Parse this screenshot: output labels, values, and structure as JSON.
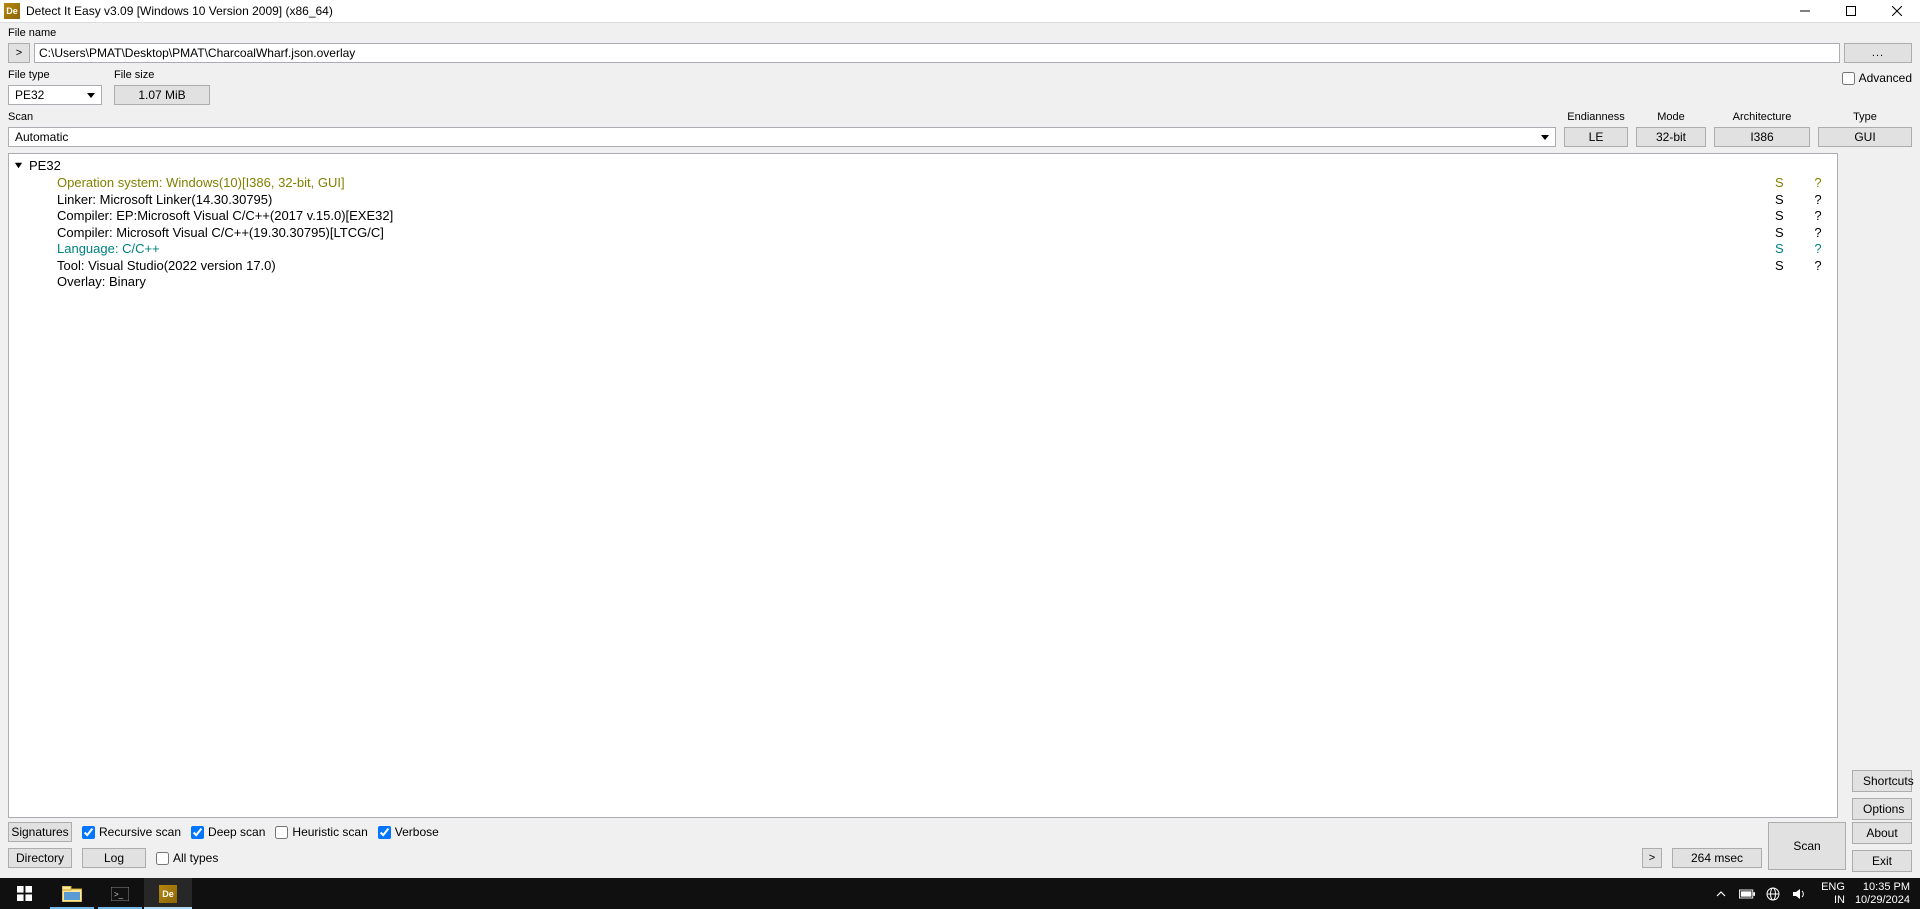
{
  "titlebar": {
    "app_icon": "De",
    "title": "Detect It Easy v3.09 [Windows 10 Version 2009] (x86_64)"
  },
  "file": {
    "filename_label": "File name",
    "path": "C:\\Users\\PMAT\\Desktop\\PMAT\\CharcoalWharf.json.overlay",
    "browse_button": "...",
    "go_button": ">",
    "filetype_label": "File type",
    "filetype_value": "PE32",
    "filesize_label": "File size",
    "filesize_value": "1.07 MiB",
    "advanced_label": "Advanced"
  },
  "scan": {
    "scan_label": "Scan",
    "mode_value": "Automatic",
    "endianness_label": "Endianness",
    "endianness_value": "LE",
    "mode_label": "Mode",
    "mode_bits": "32-bit",
    "arch_label": "Architecture",
    "arch_value": "I386",
    "type_label": "Type",
    "type_value": "GUI"
  },
  "results": {
    "root": "PE32",
    "rows": [
      {
        "text": "Operation system: Windows(10)[I386, 32-bit, GUI]",
        "cls": "olive",
        "s": "S",
        "q": "?"
      },
      {
        "text": "Linker: Microsoft Linker(14.30.30795)",
        "cls": "",
        "s": "S",
        "q": "?"
      },
      {
        "text": "Compiler: EP:Microsoft Visual C/C++(2017 v.15.0)[EXE32]",
        "cls": "",
        "s": "S",
        "q": "?"
      },
      {
        "text": "Compiler: Microsoft Visual C/C++(19.30.30795)[LTCG/C]",
        "cls": "",
        "s": "S",
        "q": "?"
      },
      {
        "text": "Language: C/C++",
        "cls": "teal",
        "s": "S",
        "q": "?"
      },
      {
        "text": "Tool: Visual Studio(2022 version 17.0)",
        "cls": "",
        "s": "S",
        "q": "?"
      },
      {
        "text": "Overlay: Binary",
        "cls": "",
        "s": "",
        "q": ""
      }
    ]
  },
  "side": {
    "shortcuts": "Shortcuts",
    "options": "Options",
    "about": "About",
    "exit": "Exit"
  },
  "bottom": {
    "signatures": "Signatures",
    "recursive": "Recursive scan",
    "deep": "Deep scan",
    "heuristic": "Heuristic scan",
    "verbose": "Verbose",
    "directory": "Directory",
    "log": "Log",
    "alltypes": "All types",
    "go": ">",
    "timing": "264 msec",
    "scan_btn": "Scan"
  },
  "taskbar": {
    "lang1": "ENG",
    "lang2": "IN",
    "time": "10:35 PM",
    "date": "10/29/2024"
  }
}
